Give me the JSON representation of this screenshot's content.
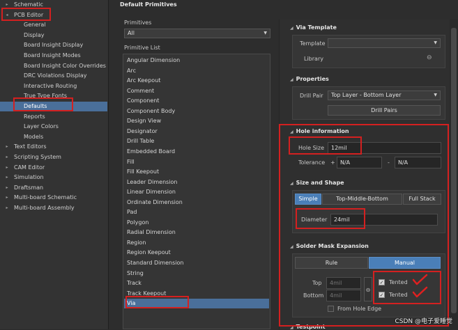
{
  "tree": [
    {
      "label": "Schematic",
      "level": 0,
      "arrow": "▸"
    },
    {
      "label": "PCB Editor",
      "level": 0,
      "arrow": "◂"
    },
    {
      "label": "General",
      "level": 1
    },
    {
      "label": "Display",
      "level": 1
    },
    {
      "label": "Board Insight Display",
      "level": 1
    },
    {
      "label": "Board Insight Modes",
      "level": 1
    },
    {
      "label": "Board Insight Color Overrides",
      "level": 1
    },
    {
      "label": "DRC Violations Display",
      "level": 1
    },
    {
      "label": "Interactive Routing",
      "level": 1
    },
    {
      "label": "True Type Fonts",
      "level": 1
    },
    {
      "label": "Defaults",
      "level": 1,
      "selected": true
    },
    {
      "label": "Reports",
      "level": 1
    },
    {
      "label": "Layer Colors",
      "level": 1
    },
    {
      "label": "Models",
      "level": 1
    },
    {
      "label": "Text Editors",
      "level": 0,
      "arrow": "▸"
    },
    {
      "label": "Scripting System",
      "level": 0,
      "arrow": "▸"
    },
    {
      "label": "CAM Editor",
      "level": 0,
      "arrow": "▸"
    },
    {
      "label": "Simulation",
      "level": 0,
      "arrow": "▸"
    },
    {
      "label": "Draftsman",
      "level": 0,
      "arrow": "▸"
    },
    {
      "label": "Multi-board Schematic",
      "level": 0,
      "arrow": "▸"
    },
    {
      "label": "Multi-board Assembly",
      "level": 0,
      "arrow": "▸"
    }
  ],
  "main": {
    "title": "Default Primitives",
    "primitives_label": "Primitives",
    "primitives_value": "All",
    "primitive_list_label": "Primitive List",
    "primitive_list": [
      "Angular Dimension",
      "Arc",
      "Arc Keepout",
      "Comment",
      "Component",
      "Component Body",
      "Design View",
      "Designator",
      "Drill Table",
      "Embedded Board",
      "Fill",
      "Fill Keepout",
      "Leader Dimension",
      "Linear Dimension",
      "Ordinate Dimension",
      "Pad",
      "Polygon",
      "Radial Dimension",
      "Region",
      "Region Keepout",
      "Standard Dimension",
      "String",
      "Track",
      "Track Keepout",
      "Via"
    ],
    "selected_primitive": "Via"
  },
  "panel": {
    "via_template": {
      "title": "Via Template",
      "template_label": "Template",
      "template_value": "",
      "library_label": "Library"
    },
    "properties": {
      "title": "Properties",
      "drill_pair_label": "Drill Pair",
      "drill_pair_value": "Top Layer - Bottom Layer",
      "drill_pairs_button": "Drill Pairs"
    },
    "hole_info": {
      "title": "Hole information",
      "hole_size_label": "Hole Size",
      "hole_size_value": "12mil",
      "tolerance_label": "Tolerance",
      "tol_plus_sign": "+",
      "tol_plus_value": "N/A",
      "tol_minus_sign": "-",
      "tol_minus_value": "N/A"
    },
    "size_shape": {
      "title": "Size and Shape",
      "tabs": [
        "Simple",
        "Top-Middle-Bottom",
        "Full Stack"
      ],
      "active_tab": "Simple",
      "diameter_label": "Diameter",
      "diameter_value": "24mil"
    },
    "solder_mask": {
      "title": "Solder Mask Expansion",
      "tabs": [
        "Rule",
        "Manual"
      ],
      "active_tab": "Manual",
      "top_label": "Top",
      "top_value": "4mil",
      "bottom_label": "Bottom",
      "bottom_value": "4mil",
      "tented_label": "Tented",
      "from_hole_edge_label": "From Hole Edge"
    },
    "testpoint": {
      "title": "Testpoint"
    }
  },
  "watermark": "CSDN @电子爱睡觉"
}
